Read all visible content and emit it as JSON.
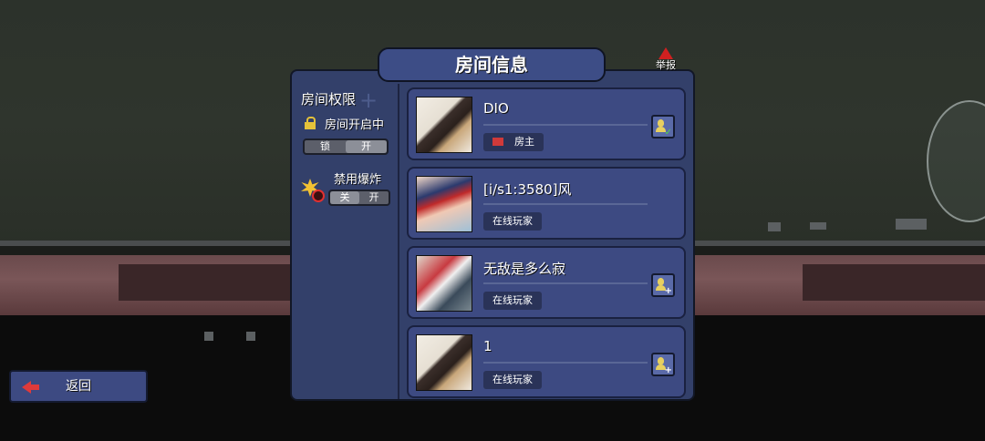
{
  "title": "房间信息",
  "report_label": "举报",
  "sidebar": {
    "permission_title": "房间权限",
    "room_status_label": "房间开启中",
    "lock_toggle": {
      "left": "锁",
      "right": "开",
      "selected": "开"
    },
    "explosion_label": "禁用爆炸",
    "explosion_toggle": {
      "left": "关",
      "right": "开",
      "selected": "关"
    }
  },
  "players": [
    {
      "name": "DIO",
      "role": "房主",
      "role_icon": "house-icon",
      "action": "player-check-icon"
    },
    {
      "name": "[i/s1:3580]风",
      "role": "在线玩家",
      "action": null
    },
    {
      "name": "无敌是多么寂",
      "role": "在线玩家",
      "action": "add-friend-icon"
    },
    {
      "name": "1",
      "role": "在线玩家",
      "action": "add-friend-icon"
    }
  ],
  "back_label": "返回",
  "colors": {
    "panel": "#33406a",
    "card": "#3d4a82",
    "title_tab": "#3d4d86",
    "accent_red": "#e03a3a",
    "icon_gold": "#e8d060"
  }
}
